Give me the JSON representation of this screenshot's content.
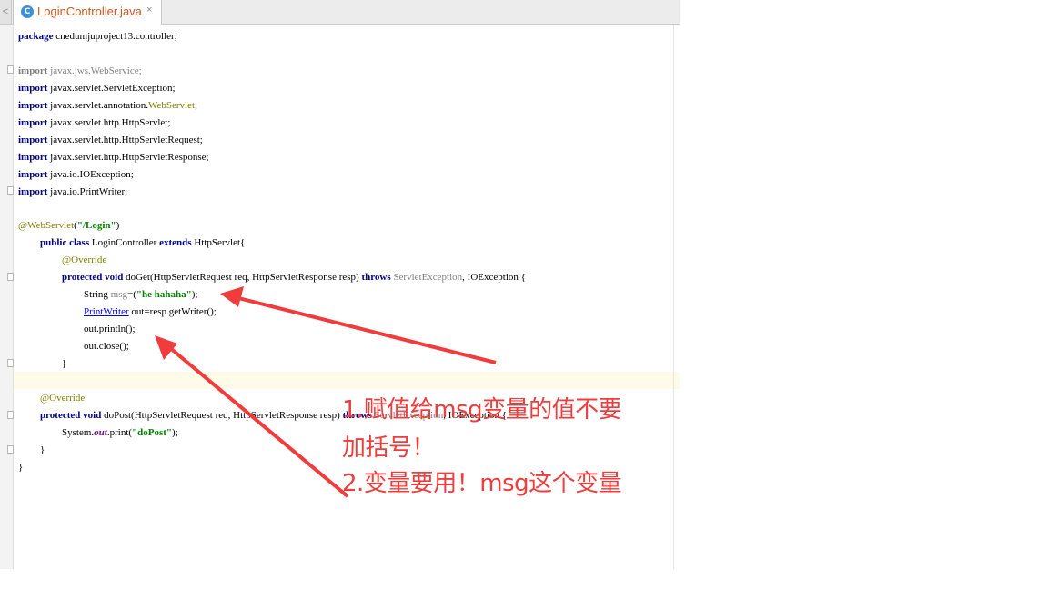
{
  "tab": {
    "scroll_left": "<",
    "icon_letter": "C",
    "label": "LoginController.java",
    "close": "×"
  },
  "code": {
    "package": {
      "kw": "package",
      "text": " cnedumjuproject13.controller;"
    },
    "imports": [
      {
        "kw": "import",
        "text": " javax.jws.WebService;"
      },
      {
        "kw": "import",
        "text": " javax.servlet.ServletException;"
      },
      {
        "kw": "import",
        "pre": " javax.servlet.annotation.",
        "ann": "WebServlet",
        "post": ";"
      },
      {
        "kw": "import",
        "text": " javax.servlet.http.HttpServlet;"
      },
      {
        "kw": "import",
        "text": " javax.servlet.http.HttpServletRequest;"
      },
      {
        "kw": "import",
        "text": " javax.servlet.http.HttpServletResponse;"
      },
      {
        "kw": "import",
        "text": " java.io.IOException;"
      },
      {
        "kw": "import",
        "text": " java.io.PrintWriter;"
      }
    ],
    "annotation": {
      "at": "@WebServlet",
      "open": "(",
      "str": "\"/Login\"",
      "close": ")"
    },
    "class_decl": {
      "kw1": "public",
      "kw2": "class",
      "name": " LoginController ",
      "kw3": "extends",
      "rest": " HttpServlet{"
    },
    "override1": "@Override",
    "doget": {
      "kw1": "protected",
      "kw2": "void",
      "sig": " doGet(HttpServletRequest req, HttpServletResponse resp) ",
      "kw3": "throws",
      "exc1": " ServletException",
      "rest": ", IOException {"
    },
    "line_msg": {
      "pre": "String ",
      "var": "msg",
      "eq": "=(",
      "str": "\"he hahaha\"",
      "post": ");"
    },
    "line_writer": {
      "type": "PrintWriter",
      "rest": " out=resp.getWriter();"
    },
    "line_println": "out.println();",
    "line_close": "out.close();",
    "brace_method": "}",
    "override2": "@Override",
    "dopost": {
      "kw1": "protected",
      "kw2": "void",
      "sig": " doPost(HttpServletRequest req, HttpServletResponse resp) ",
      "kw3": "throws",
      "exc1": " ServletException",
      "rest": ", IOException {"
    },
    "line_print": {
      "pre": "System.",
      "out": "out",
      "post": ".print(",
      "str": "\"doPost\"",
      "end": ");"
    },
    "brace_method2": "}",
    "brace_class": "}"
  },
  "notes": {
    "line1": "1.赋值给msg变量的值不要",
    "line2": "加括号！",
    "line3": "2.变量要用！msg这个变量"
  },
  "colors": {
    "keyword": "#000080",
    "string": "#008000",
    "annotation": "#808000",
    "annotation_red": "#f03c3c",
    "tab_label": "#c25a25"
  }
}
